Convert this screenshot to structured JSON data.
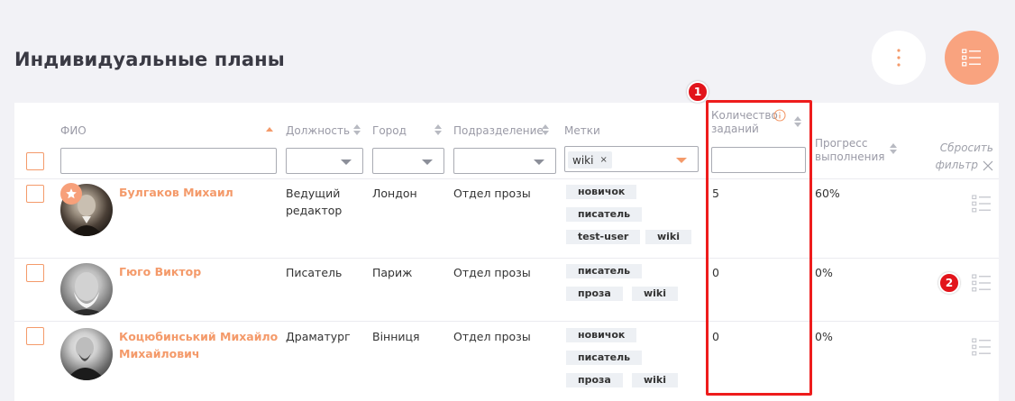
{
  "page": {
    "title": "Индивидуальные планы"
  },
  "header_actions": {
    "more_icon": "more-vertical-icon",
    "list_icon": "list-icon"
  },
  "colors": {
    "accent": "#f49a6a",
    "annotation": "#e2141b",
    "tag_bg": "#edf0f4"
  },
  "table": {
    "columns": {
      "fio": "ФИО",
      "position": "Должность",
      "city": "Город",
      "department": "Подразделение",
      "tags": "Метки",
      "tasks_line1": "Количество",
      "tasks_line2": "заданий",
      "progress_line1": "Прогресс",
      "progress_line2": "выполнения"
    },
    "filters": {
      "fio": "",
      "position": "",
      "city": "",
      "department": "",
      "tags_selected": "wiki",
      "tags_chip_close": "×",
      "tasks": ""
    },
    "reset_filter_line1": "Сбросить",
    "reset_filter_line2": "фильтр",
    "rows": [
      {
        "name": "Булгаков Михаил",
        "position_line1": "Ведущий",
        "position_line2": "редактор",
        "city": "Лондон",
        "department": "Отдел прозы",
        "tags": [
          "новичок",
          "писатель",
          "test-user",
          "wiki"
        ],
        "tasks": "5",
        "progress": "60%",
        "starred": true
      },
      {
        "name": "Гюго Виктор",
        "position_line1": "Писатель",
        "position_line2": "",
        "city": "Париж",
        "department": "Отдел прозы",
        "tags": [
          "писатель",
          "проза",
          "wiki"
        ],
        "tasks": "0",
        "progress": "0%",
        "starred": false
      },
      {
        "name_line1": "Коцюбинський Михайло",
        "name_line2": "Михайлович",
        "position_line1": "Драматург",
        "position_line2": "",
        "city": "Вінниця",
        "department": "Отдел прозы",
        "tags": [
          "новичок",
          "писатель",
          "проза",
          "wiki"
        ],
        "tasks": "0",
        "progress": "0%",
        "starred": false
      }
    ]
  },
  "annotations": {
    "marker_1": "1",
    "marker_2": "2"
  }
}
